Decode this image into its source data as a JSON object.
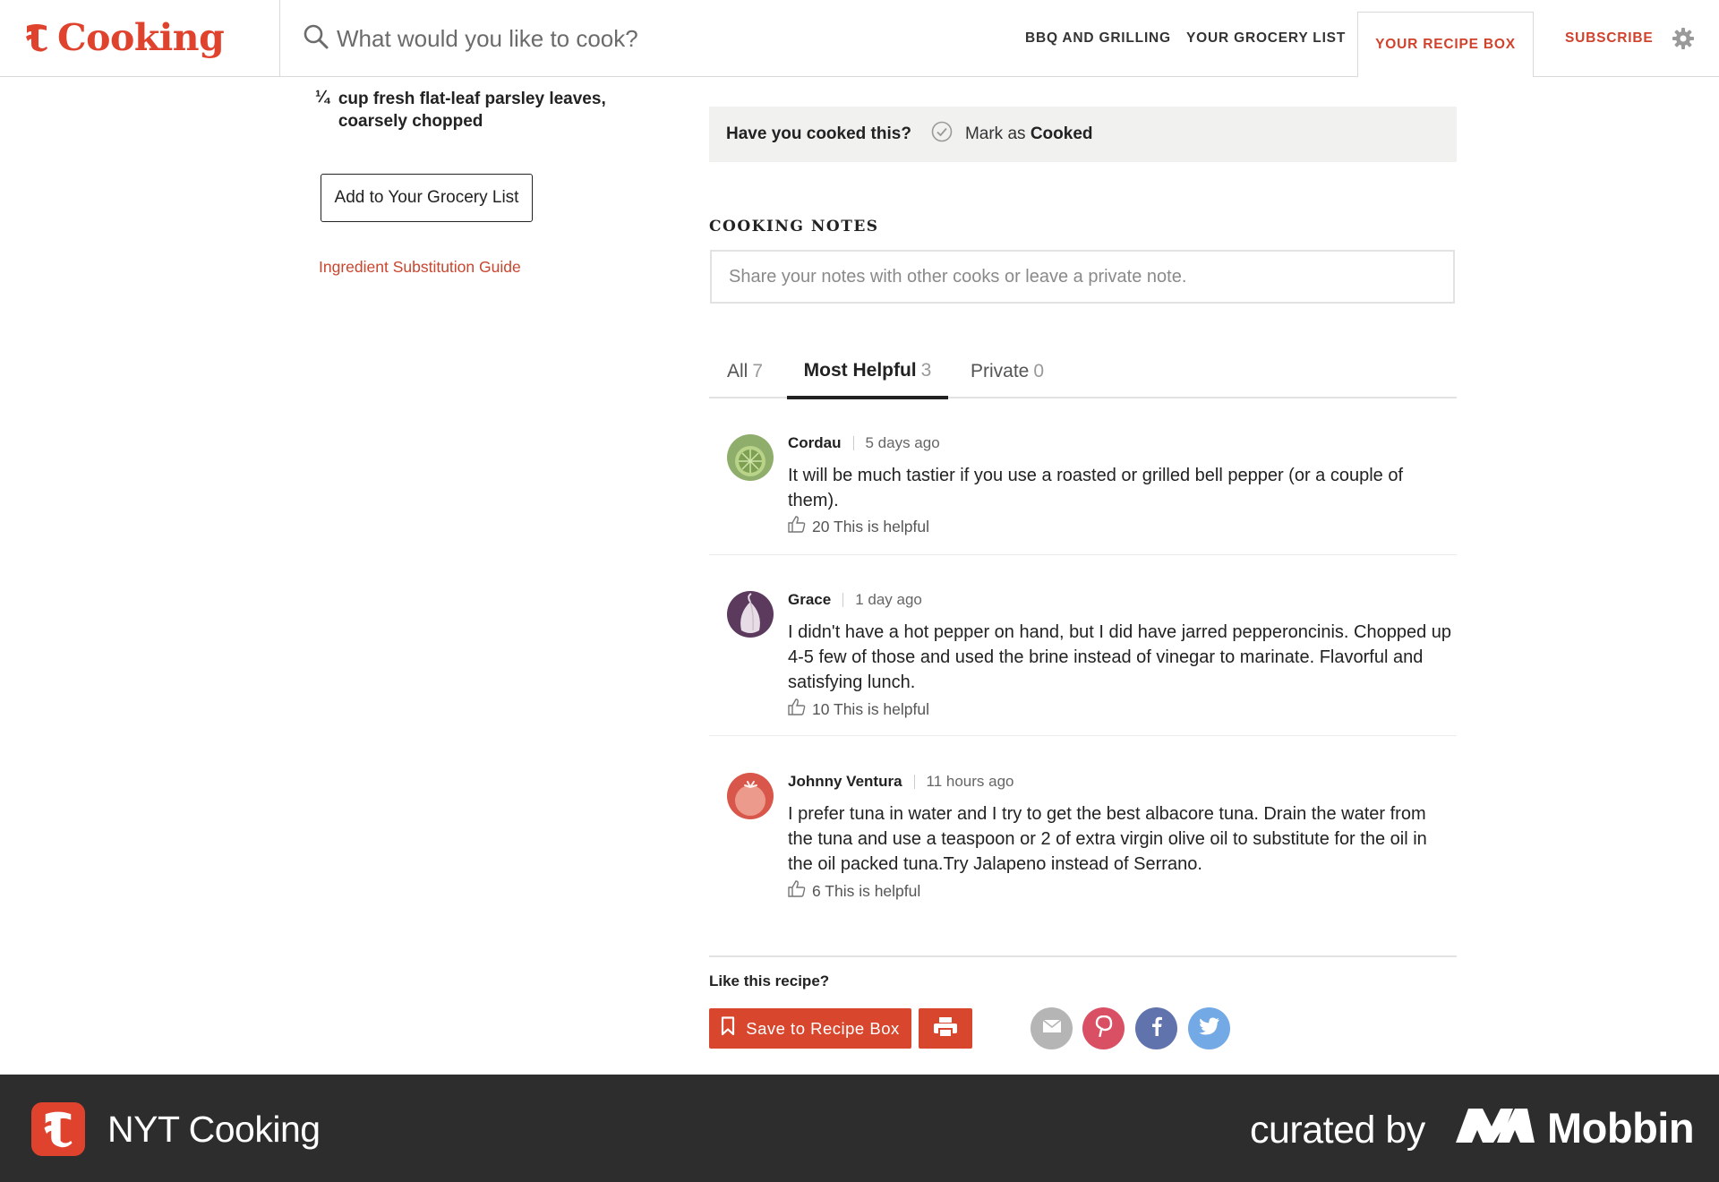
{
  "header": {
    "logo_glyph": "𝕿",
    "logo_text": "Cooking",
    "search_placeholder": "What would you like to cook?",
    "nav": {
      "bbq": "BBQ AND GRILLING",
      "grocery": "YOUR GROCERY LIST",
      "recipe_box": "YOUR RECIPE BOX",
      "subscribe": "SUBSCRIBE"
    },
    "brand_color": "#e0432d"
  },
  "ingredients": {
    "quantity": "¼",
    "text": "cup fresh flat-leaf parsley leaves, coarsely chopped",
    "add_button": "Add to Your Grocery List",
    "substitution_link": "Ingredient Substitution Guide"
  },
  "cooked": {
    "question": "Have you cooked this?",
    "mark_prefix": "Mark as",
    "mark_bold": "Cooked"
  },
  "notes": {
    "title": "COOKING NOTES",
    "placeholder": "Share your notes with other cooks or leave a private note.",
    "tabs": [
      {
        "label": "All",
        "count": "7"
      },
      {
        "label": "Most Helpful",
        "count": "3",
        "active": true
      },
      {
        "label": "Private",
        "count": "0"
      }
    ],
    "comments": [
      {
        "name": "Cordau",
        "time": "5 days ago",
        "body": "It will be much tastier if you use a roasted or grilled bell pepper (or a couple of them).",
        "helpful": "20 This is helpful",
        "avatar": "lime-icon"
      },
      {
        "name": "Grace",
        "time": "1 day ago",
        "body": "I didn't have a hot pepper on hand, but I did have jarred pepperoncinis. Chopped up 4-5 few of those and used the brine instead of vinegar to marinate. Flavorful and satisfying lunch.",
        "helpful": "10 This is helpful",
        "avatar": "onion-icon"
      },
      {
        "name": "Johnny Ventura",
        "time": "11 hours ago",
        "body": "I prefer tuna in water and I try to get the best albacore tuna. Drain the water from the tuna and use a teaspoon or 2 of extra virgin olive oil to substitute for the oil in the oil packed tuna.Try Jalapeno instead of Serrano.",
        "helpful": "6 This is helpful",
        "avatar": "tomato-icon"
      }
    ]
  },
  "share": {
    "title": "Like this recipe?",
    "save_label": "Save to Recipe Box",
    "accent": "#d9462e"
  },
  "footer": {
    "app_name": "NYT Cooking",
    "curated_by": "curated by",
    "brand": "Mobbin"
  }
}
